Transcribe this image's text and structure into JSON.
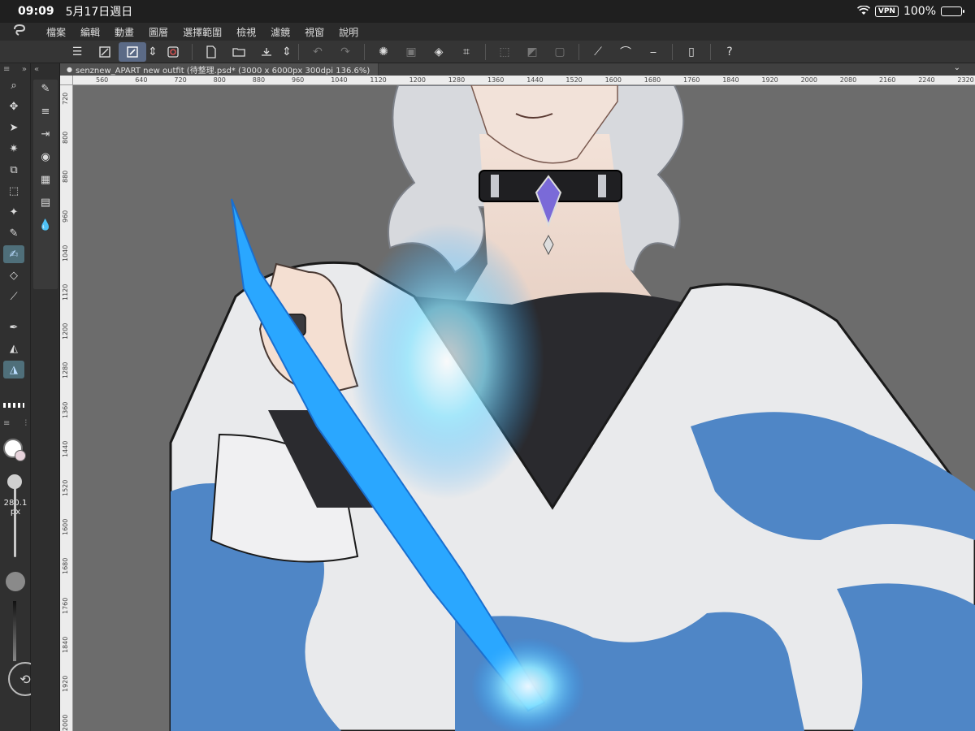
{
  "status_bar": {
    "time": "09:09",
    "date": "5月17日週日",
    "vpn": "VPN",
    "battery": "100%"
  },
  "menu": {
    "items": [
      "檔案",
      "編輯",
      "動畫",
      "圖層",
      "選擇範圍",
      "檢視",
      "濾鏡",
      "視窗",
      "說明"
    ]
  },
  "document": {
    "tab_title": "senznew_APART new outfit (待整理.psd* (3000 x 6000px 300dpi 136.6%)"
  },
  "ruler": {
    "horizontal": [
      "560",
      "640",
      "720",
      "800",
      "880",
      "960",
      "1040",
      "1120",
      "1200",
      "1280",
      "1360",
      "1440",
      "1520",
      "1600",
      "1680",
      "1760",
      "1840",
      "1920",
      "2000",
      "2080",
      "2160",
      "2240",
      "2320"
    ],
    "vertical": [
      "720",
      "800",
      "880",
      "960",
      "1040",
      "1120",
      "1200",
      "1280",
      "1360",
      "1440",
      "1520",
      "1600",
      "1680",
      "1760",
      "1840",
      "1920",
      "2000"
    ]
  },
  "brush": {
    "size_value": "280.1",
    "size_unit": "px"
  },
  "colors": {
    "foreground": "#ffffff",
    "background": "#e8d4dc",
    "accent": "#5b6a86"
  },
  "icons": {
    "toolbar": [
      "menu-icon",
      "canvas-fit-icon",
      "transform-icon",
      "spiral-icon",
      "new-file-icon",
      "open-folder-icon",
      "save-icon",
      "undo-icon",
      "redo-icon",
      "loading-icon",
      "copy-icon",
      "fill-icon",
      "crop-icon",
      "deselect-icon",
      "invert-icon",
      "border-icon",
      "ruler-pen-icon",
      "brush-stroke-icon",
      "pen-line-icon",
      "device-icon",
      "help-icon"
    ],
    "tools": [
      "zoom-icon",
      "move-icon",
      "operation-icon",
      "magic-wand-icon",
      "layer-move-icon",
      "selection-icon",
      "sparkle-icon",
      "pen-icon",
      "brush-active-icon",
      "eraser-icon",
      "eyedropper-icon",
      "pen-nib-icon",
      "fill-bucket-icon",
      "gradient-icon"
    ]
  }
}
